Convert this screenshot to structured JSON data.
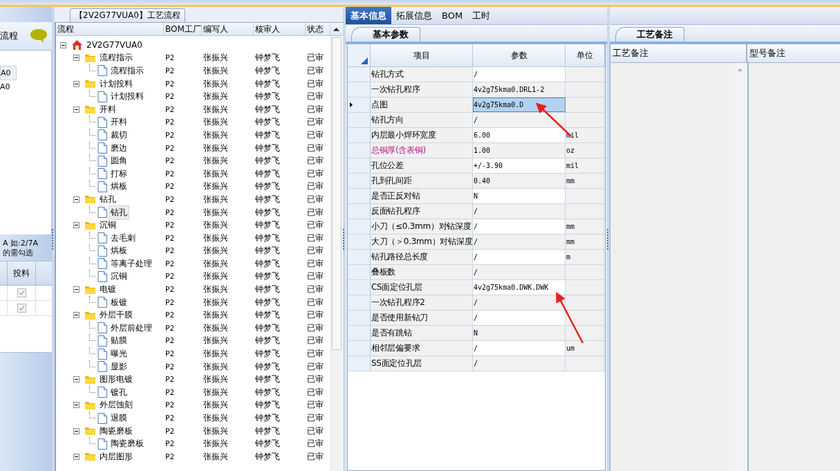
{
  "left_panel": {
    "title": "流程",
    "items": [
      {
        "label": "A0",
        "selected": true
      },
      {
        "label": "A0",
        "selected": false
      }
    ],
    "note_lines": [
      "A 如:2/7A",
      "的需勾选"
    ],
    "table": {
      "column": "投料",
      "rows": [
        {
          "checked": true,
          "disabled": true
        },
        {
          "checked": true,
          "disabled": true
        }
      ]
    }
  },
  "process_panel": {
    "title": "【2V2G77VUA0】工艺流程",
    "columns": [
      "流程",
      "BOM工厂",
      "编写人",
      "核审人",
      "状态"
    ],
    "tree": {
      "name": "2V2G77VUA0",
      "kind": "root",
      "expanded": true,
      "selected": false,
      "children": [
        {
          "name": "流程指示",
          "kind": "folder",
          "expanded": true,
          "selected": false,
          "factory": "P2",
          "writer": "张振兴",
          "reviewer": "钟梦飞",
          "status": "已审",
          "children": [
            {
              "name": "流程指示",
              "kind": "file",
              "selected": false,
              "factory": "P2",
              "writer": "张振兴",
              "reviewer": "钟梦飞",
              "status": "已审"
            }
          ]
        },
        {
          "name": "计划投料",
          "kind": "folder",
          "expanded": true,
          "selected": false,
          "factory": "P2",
          "writer": "张振兴",
          "reviewer": "钟梦飞",
          "status": "已审",
          "children": [
            {
              "name": "计划投料",
              "kind": "file",
              "selected": false,
              "factory": "P2",
              "writer": "张振兴",
              "reviewer": "钟梦飞",
              "status": "已审"
            }
          ]
        },
        {
          "name": "开料",
          "kind": "folder",
          "expanded": true,
          "selected": false,
          "factory": "P2",
          "writer": "张振兴",
          "reviewer": "钟梦飞",
          "status": "已审",
          "children": [
            {
              "name": "开料",
              "kind": "file",
              "selected": false,
              "factory": "P2",
              "writer": "张振兴",
              "reviewer": "钟梦飞",
              "status": "已审"
            },
            {
              "name": "裁切",
              "kind": "file",
              "selected": false,
              "factory": "P2",
              "writer": "张振兴",
              "reviewer": "钟梦飞",
              "status": "已审"
            },
            {
              "name": "磨边",
              "kind": "file",
              "selected": false,
              "factory": "P2",
              "writer": "张振兴",
              "reviewer": "钟梦飞",
              "status": "已审"
            },
            {
              "name": "圆角",
              "kind": "file",
              "selected": false,
              "factory": "P2",
              "writer": "张振兴",
              "reviewer": "钟梦飞",
              "status": "已审"
            },
            {
              "name": "打标",
              "kind": "file",
              "selected": false,
              "factory": "P2",
              "writer": "张振兴",
              "reviewer": "钟梦飞",
              "status": "已审"
            },
            {
              "name": "烘板",
              "kind": "file",
              "selected": false,
              "factory": "P2",
              "writer": "张振兴",
              "reviewer": "钟梦飞",
              "status": "已审"
            }
          ]
        },
        {
          "name": "钻孔",
          "kind": "folder",
          "expanded": true,
          "selected": false,
          "factory": "P2",
          "writer": "张振兴",
          "reviewer": "钟梦飞",
          "status": "已审",
          "children": [
            {
              "name": "钻孔",
              "kind": "file",
              "selected": true,
              "factory": "P2",
              "writer": "张振兴",
              "reviewer": "钟梦飞",
              "status": "已审"
            }
          ]
        },
        {
          "name": "沉铜",
          "kind": "folder",
          "expanded": true,
          "selected": false,
          "factory": "P2",
          "writer": "张振兴",
          "reviewer": "钟梦飞",
          "status": "已审",
          "children": [
            {
              "name": "去毛刺",
              "kind": "file",
              "selected": false,
              "factory": "P2",
              "writer": "张振兴",
              "reviewer": "钟梦飞",
              "status": "已审"
            },
            {
              "name": "烘板",
              "kind": "file",
              "selected": false,
              "factory": "P2",
              "writer": "张振兴",
              "reviewer": "钟梦飞",
              "status": "已审"
            },
            {
              "name": "等离子处理",
              "kind": "file",
              "selected": false,
              "factory": "P2",
              "writer": "张振兴",
              "reviewer": "钟梦飞",
              "status": "已审"
            },
            {
              "name": "沉铜",
              "kind": "file",
              "selected": false,
              "factory": "P2",
              "writer": "张振兴",
              "reviewer": "钟梦飞",
              "status": "已审"
            }
          ]
        },
        {
          "name": "电镀",
          "kind": "folder",
          "expanded": true,
          "selected": false,
          "factory": "P2",
          "writer": "张振兴",
          "reviewer": "钟梦飞",
          "status": "已审",
          "children": [
            {
              "name": "板镀",
              "kind": "file",
              "selected": false,
              "factory": "P2",
              "writer": "张振兴",
              "reviewer": "钟梦飞",
              "status": "已审"
            }
          ]
        },
        {
          "name": "外层干膜",
          "kind": "folder",
          "expanded": true,
          "selected": false,
          "factory": "P2",
          "writer": "张振兴",
          "reviewer": "钟梦飞",
          "status": "已审",
          "children": [
            {
              "name": "外层前处理",
              "kind": "file",
              "selected": false,
              "factory": "P2",
              "writer": "张振兴",
              "reviewer": "钟梦飞",
              "status": "已审"
            },
            {
              "name": "贴膜",
              "kind": "file",
              "selected": false,
              "factory": "P2",
              "writer": "张振兴",
              "reviewer": "钟梦飞",
              "status": "已审"
            },
            {
              "name": "曝光",
              "kind": "file",
              "selected": false,
              "factory": "P2",
              "writer": "张振兴",
              "reviewer": "钟梦飞",
              "status": "已审"
            },
            {
              "name": "显影",
              "kind": "file",
              "selected": false,
              "factory": "P2",
              "writer": "张振兴",
              "reviewer": "钟梦飞",
              "status": "已审"
            }
          ]
        },
        {
          "name": "图形电镀",
          "kind": "folder",
          "expanded": true,
          "selected": false,
          "factory": "P2",
          "writer": "张振兴",
          "reviewer": "钟梦飞",
          "status": "已审",
          "children": [
            {
              "name": "镀孔",
              "kind": "file",
              "selected": false,
              "factory": "P2",
              "writer": "张振兴",
              "reviewer": "钟梦飞",
              "status": "已审"
            }
          ]
        },
        {
          "name": "外层蚀刻",
          "kind": "folder",
          "expanded": true,
          "selected": false,
          "factory": "P2",
          "writer": "张振兴",
          "reviewer": "钟梦飞",
          "status": "已审",
          "children": [
            {
              "name": "退膜",
              "kind": "file",
              "selected": false,
              "factory": "P2",
              "writer": "张振兴",
              "reviewer": "钟梦飞",
              "status": "已审"
            }
          ]
        },
        {
          "name": "陶瓷磨板",
          "kind": "folder",
          "expanded": true,
          "selected": false,
          "factory": "P2",
          "writer": "张振兴",
          "reviewer": "钟梦飞",
          "status": "已审",
          "children": [
            {
              "name": "陶瓷磨板",
              "kind": "file",
              "selected": false,
              "factory": "P2",
              "writer": "张振兴",
              "reviewer": "钟梦飞",
              "status": "已审"
            }
          ]
        },
        {
          "name": "内层图形",
          "kind": "folder",
          "expanded": true,
          "selected": false,
          "factory": "P2",
          "writer": "张振兴",
          "reviewer": "钟梦飞",
          "status": "已审"
        }
      ]
    }
  },
  "detail_panel": {
    "tabs": [
      {
        "label": "基本信息",
        "selected": true
      },
      {
        "label": "拓展信息",
        "selected": false
      },
      {
        "label": "BOM",
        "selected": false
      },
      {
        "label": "工时",
        "selected": false
      }
    ],
    "subtab": "基本参数",
    "columns": [
      "项目",
      "参数",
      "单位"
    ],
    "rows": [
      {
        "item": "钻孔方式",
        "value": "/",
        "emphasis": false,
        "selected": false
      },
      {
        "item": "一次钻孔程序",
        "value": "4v2g75kma0.DRL1-2",
        "emphasis": false,
        "selected": false
      },
      {
        "item": "点图",
        "value": "4v2g75kma0.D",
        "emphasis": false,
        "selected": true
      },
      {
        "item": "钻孔方向",
        "value": "/",
        "emphasis": false,
        "selected": false
      },
      {
        "item": "内层最小焊环宽度",
        "value": "6.00",
        "unit": "mil",
        "emphasis": false,
        "selected": false
      },
      {
        "item": "总铜厚(含表铜)",
        "value": "1.00",
        "unit": "oz",
        "emphasis": true,
        "selected": false
      },
      {
        "item": "孔位公差",
        "value": "+/-3.90",
        "unit": "mil",
        "emphasis": false,
        "selected": false
      },
      {
        "item": "孔到孔间距",
        "value": "0.40",
        "unit": "mm",
        "emphasis": false,
        "selected": false
      },
      {
        "item": "是否正反对钻",
        "value": "N",
        "emphasis": false,
        "selected": false
      },
      {
        "item": "反面钻孔程序",
        "value": "/",
        "emphasis": false,
        "selected": false
      },
      {
        "item": "小刀（≤0.3mm）对钻深度",
        "value": "/",
        "unit": "mm",
        "emphasis": false,
        "selected": false
      },
      {
        "item": "大刀（＞0.3mm）对钻深度",
        "value": "/",
        "unit": "mm",
        "emphasis": false,
        "selected": false
      },
      {
        "item": "钻孔路径总长度",
        "value": "/",
        "unit": "m",
        "emphasis": false,
        "selected": false
      },
      {
        "item": "叠板数",
        "value": "/",
        "emphasis": false,
        "selected": false
      },
      {
        "item": "CS面定位孔层",
        "value": "4v2g75kma0.DWK.DWK",
        "emphasis": false,
        "selected": false
      },
      {
        "item": "一次钻孔程序2",
        "value": "/",
        "emphasis": false,
        "selected": false
      },
      {
        "item": "是否使用新钻刀",
        "value": "/",
        "emphasis": false,
        "selected": false
      },
      {
        "item": "是否有跳钻",
        "value": "N",
        "emphasis": false,
        "selected": false
      },
      {
        "item": "相邻层偏要求",
        "value": "/",
        "unit": "um",
        "emphasis": false,
        "selected": false
      },
      {
        "item": "SS面定位孔层",
        "value": "/",
        "emphasis": false,
        "selected": false
      }
    ]
  },
  "notes_panel": {
    "tab": "工艺备注",
    "columns": [
      "工艺备注",
      "型号备注"
    ]
  }
}
